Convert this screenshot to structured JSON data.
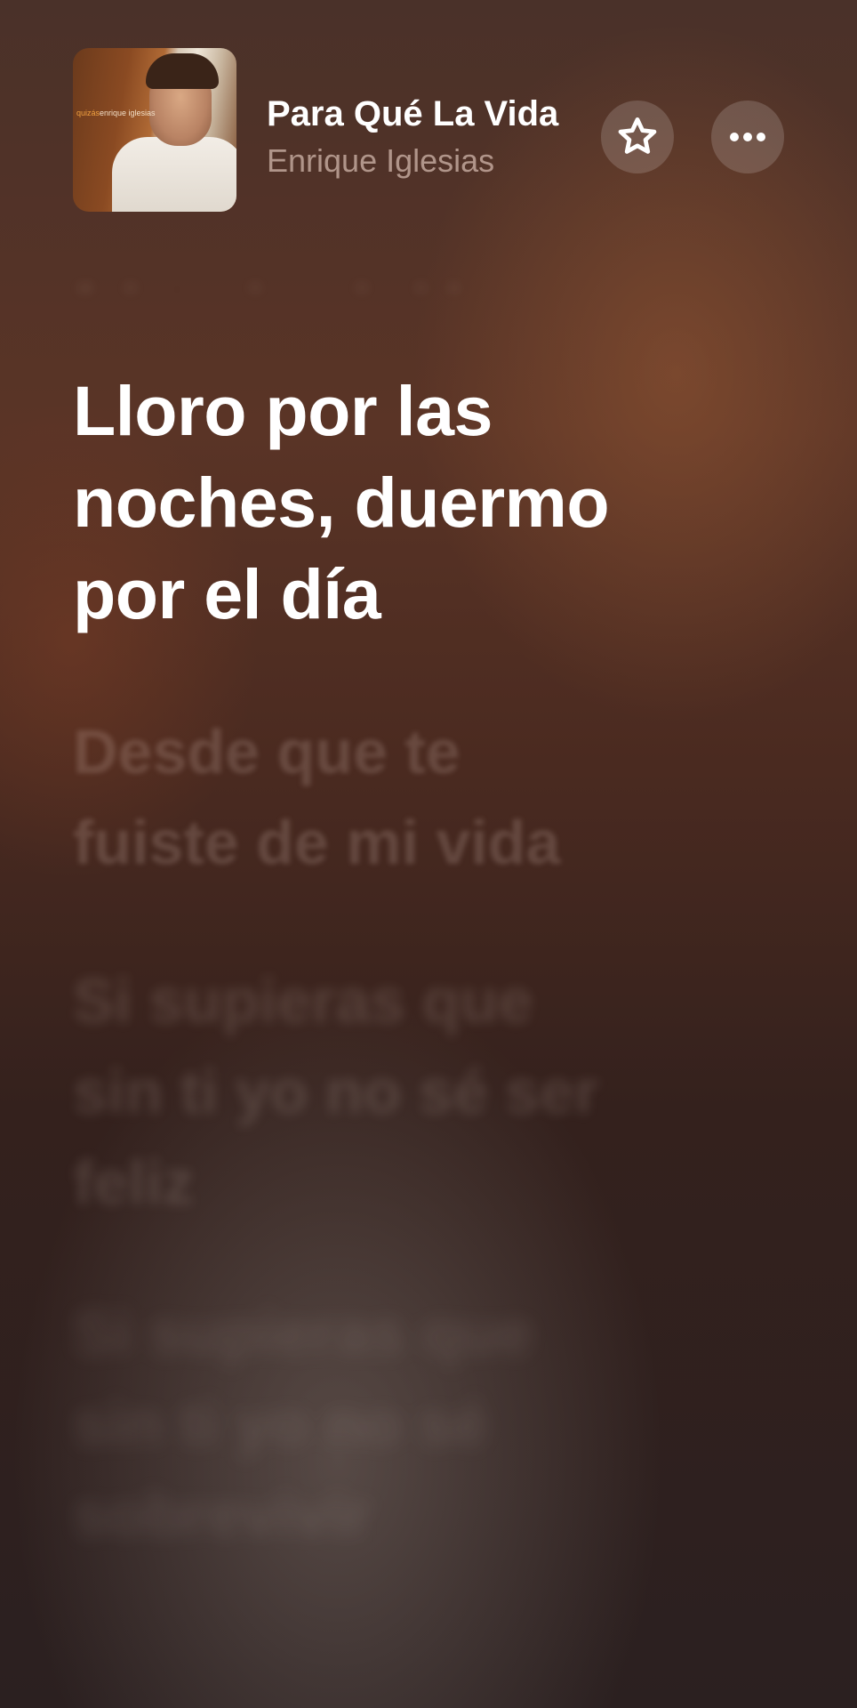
{
  "header": {
    "album_art": {
      "label_accent": "quizás",
      "label_artist": "enrique iglesias"
    },
    "title": "Para Qué La Vida",
    "artist": "Enrique Iglesias",
    "favorite_icon": "star-icon",
    "more_icon": "ellipsis-icon"
  },
  "lyrics": {
    "previous": "fuiste de mi vida",
    "current": "Lloro por las\nnoches, duermo\npor el día",
    "upcoming": [
      "Desde que te\nfuiste de mi vida",
      "Si supieras que\nsin ti yo no sé ser\nfeliz",
      "Si supieras que\nsin ti yo no sé\nsobrevivir"
    ]
  },
  "colors": {
    "background_top": "#4a3129",
    "background_bottom": "#2b2020",
    "active_lyric": "#ffffff",
    "artist_text": "#ebd2c6"
  }
}
